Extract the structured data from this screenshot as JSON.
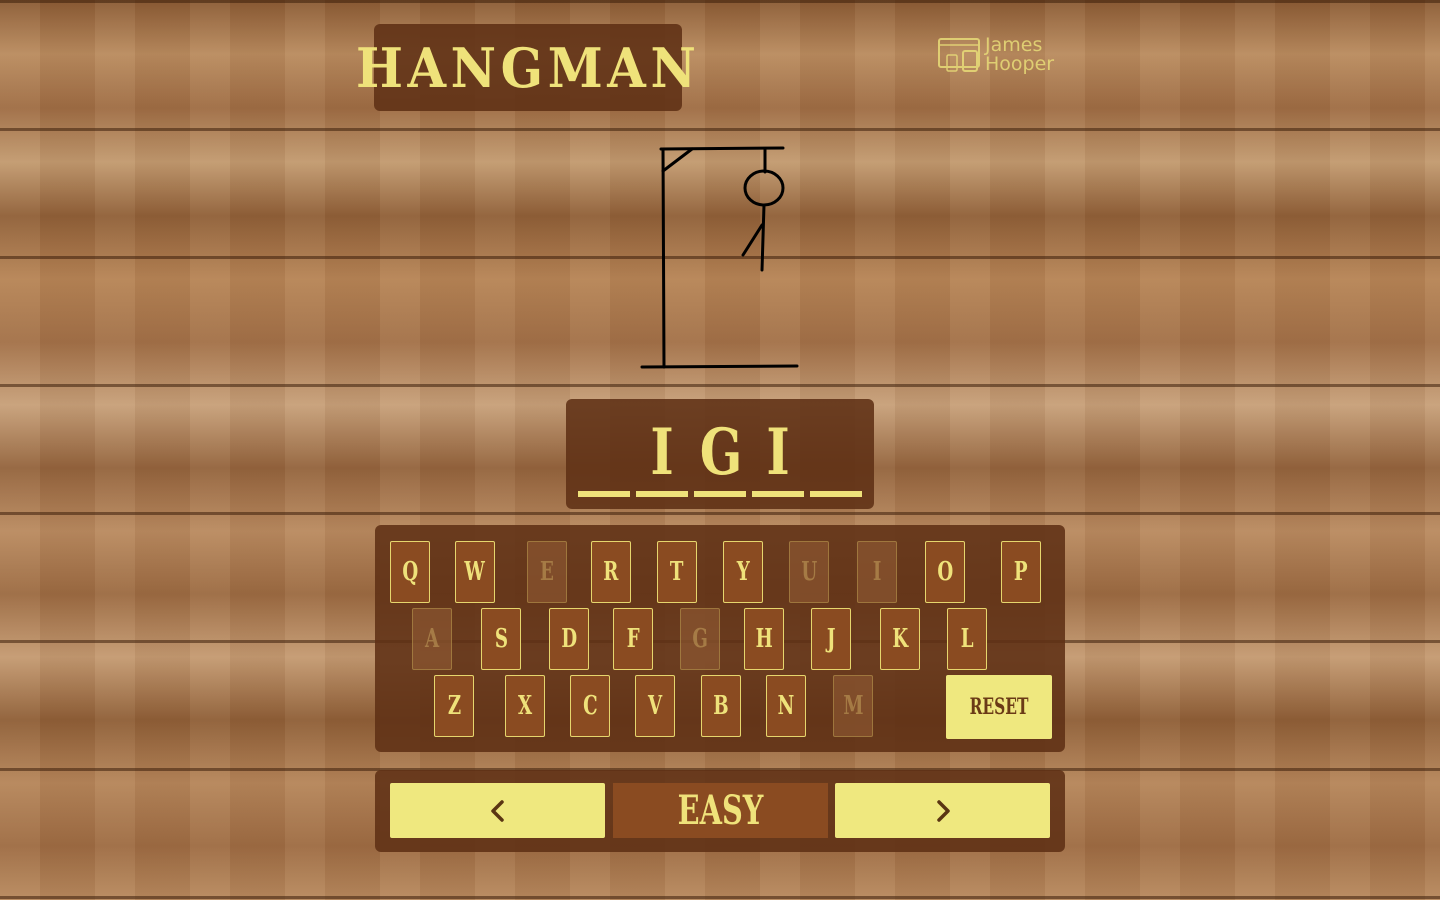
{
  "app": {
    "title": "HANGMAN",
    "brand": {
      "line1": "James",
      "line2": "Hooper",
      "icon": "devices-icon"
    }
  },
  "word": {
    "slots": [
      "",
      "I",
      "G",
      "I",
      ""
    ]
  },
  "keyboard": {
    "rows": [
      [
        {
          "letter": "Q",
          "used": false
        },
        {
          "letter": "W",
          "used": false
        },
        {
          "letter": "E",
          "used": true
        },
        {
          "letter": "R",
          "used": false
        },
        {
          "letter": "T",
          "used": false
        },
        {
          "letter": "Y",
          "used": false
        },
        {
          "letter": "U",
          "used": true
        },
        {
          "letter": "I",
          "used": true
        },
        {
          "letter": "O",
          "used": false
        },
        {
          "letter": "P",
          "used": false
        }
      ],
      [
        {
          "letter": "A",
          "used": true
        },
        {
          "letter": "S",
          "used": false
        },
        {
          "letter": "D",
          "used": false
        },
        {
          "letter": "F",
          "used": false
        },
        {
          "letter": "G",
          "used": true
        },
        {
          "letter": "H",
          "used": false
        },
        {
          "letter": "J",
          "used": false
        },
        {
          "letter": "K",
          "used": false
        },
        {
          "letter": "L",
          "used": false
        }
      ],
      [
        {
          "letter": "Z",
          "used": false
        },
        {
          "letter": "X",
          "used": false
        },
        {
          "letter": "C",
          "used": false
        },
        {
          "letter": "V",
          "used": false
        },
        {
          "letter": "B",
          "used": false
        },
        {
          "letter": "N",
          "used": false
        },
        {
          "letter": "M",
          "used": true
        }
      ]
    ],
    "reset_label": "RESET"
  },
  "difficulty": {
    "label": "EASY",
    "prev_icon": "chevron-left-icon",
    "next_icon": "chevron-right-icon"
  },
  "hangman": {
    "parts_drawn": [
      "head",
      "body",
      "left-leg"
    ]
  },
  "colors": {
    "accent": "#efe27a",
    "panel": "#5f3014",
    "key": "#8a4b21"
  }
}
